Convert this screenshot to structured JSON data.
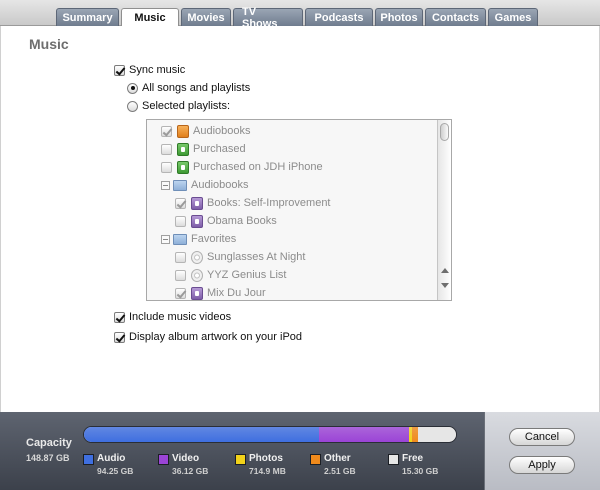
{
  "tabs": [
    {
      "label": "Summary",
      "active": false
    },
    {
      "label": "Music",
      "active": true
    },
    {
      "label": "Movies",
      "active": false
    },
    {
      "label": "TV Shows",
      "active": false
    },
    {
      "label": "Podcasts",
      "active": false
    },
    {
      "label": "Photos",
      "active": false
    },
    {
      "label": "Contacts",
      "active": false
    },
    {
      "label": "Games",
      "active": false
    }
  ],
  "section_title": "Music",
  "sync_music": {
    "label": "Sync music",
    "checked": true
  },
  "sync_options": {
    "all_label": "All songs and playlists",
    "all_selected": true,
    "selected_label": "Selected playlists:",
    "selected_selected": false
  },
  "playlists": [
    {
      "label": "Audiobooks",
      "icon": "audiobook-icon",
      "checked": true,
      "indent": 0,
      "folder": false
    },
    {
      "label": "Purchased",
      "icon": "purchased-playlist-icon",
      "checked": false,
      "indent": 0,
      "folder": false
    },
    {
      "label": "Purchased on JDH iPhone",
      "icon": "purchased-playlist-icon",
      "checked": false,
      "indent": 0,
      "folder": false
    },
    {
      "label": "Audiobooks",
      "icon": "folder-icon",
      "checked": false,
      "indent": 0,
      "folder": true
    },
    {
      "label": "Books: Self-Improvement",
      "icon": "book-playlist-icon",
      "checked": true,
      "indent": 1,
      "folder": false
    },
    {
      "label": "Obama Books",
      "icon": "book-playlist-icon",
      "checked": false,
      "indent": 1,
      "folder": false
    },
    {
      "label": "Favorites",
      "icon": "folder-icon",
      "checked": false,
      "indent": 0,
      "folder": true
    },
    {
      "label": "Sunglasses At Night",
      "icon": "smart-playlist-icon",
      "checked": false,
      "indent": 1,
      "folder": false
    },
    {
      "label": "YYZ Genius List",
      "icon": "smart-playlist-icon",
      "checked": false,
      "indent": 1,
      "folder": false
    },
    {
      "label": "Mix Du Jour",
      "icon": "book-playlist-icon",
      "checked": true,
      "indent": 1,
      "folder": false
    }
  ],
  "include_videos": {
    "label": "Include music videos",
    "checked": true
  },
  "display_artwork": {
    "label": "Display album artwork on your iPod",
    "checked": true
  },
  "capacity": {
    "label": "Capacity",
    "total": "148.87 GB",
    "segments": [
      {
        "name": "Audio",
        "value": "94.25 GB",
        "gb": 94.25,
        "color": "#3f6fe0"
      },
      {
        "name": "Video",
        "value": "36.12 GB",
        "gb": 36.12,
        "color": "#9b44d6"
      },
      {
        "name": "Photos",
        "value": "714.9 MB",
        "gb": 0.71,
        "color": "#f2d21a"
      },
      {
        "name": "Other",
        "value": "2.51 GB",
        "gb": 2.51,
        "color": "#f08a1c"
      },
      {
        "name": "Free",
        "value": "15.30 GB",
        "gb": 15.3,
        "color": "#e6e6e6"
      }
    ]
  },
  "buttons": {
    "cancel": "Cancel",
    "apply": "Apply"
  }
}
